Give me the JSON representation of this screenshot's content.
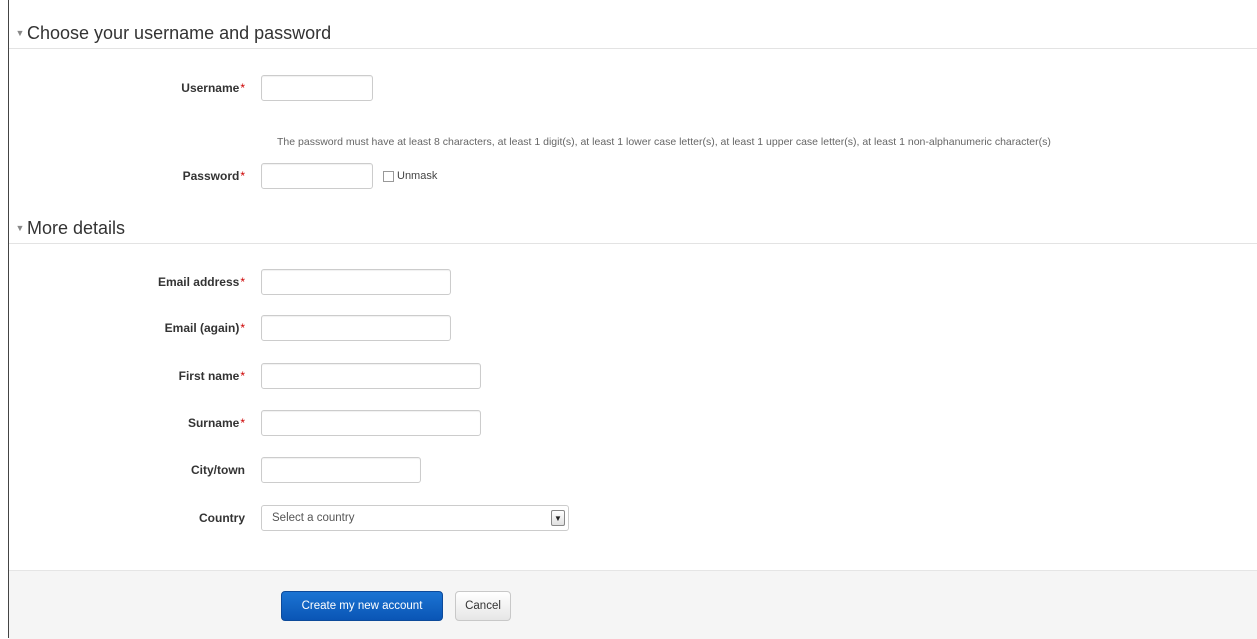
{
  "sections": {
    "credentials": {
      "title": "Choose your username and password",
      "caret": "▼"
    },
    "details": {
      "title": "More details",
      "caret": "▼"
    }
  },
  "fields": {
    "username": {
      "label": "Username",
      "required_marker": "*",
      "value": ""
    },
    "password_help": "The password must have at least 8 characters, at least 1 digit(s), at least 1 lower case letter(s), at least 1 upper case letter(s), at least 1 non-alphanumeric character(s)",
    "password": {
      "label": "Password",
      "required_marker": "*",
      "value": ""
    },
    "unmask": {
      "label": "Unmask",
      "checked": false
    },
    "email": {
      "label": "Email address",
      "required_marker": "*",
      "value": ""
    },
    "email_again": {
      "label": "Email (again)",
      "required_marker": "*",
      "value": ""
    },
    "first_name": {
      "label": "First name",
      "required_marker": "*",
      "value": ""
    },
    "surname": {
      "label": "Surname",
      "required_marker": "*",
      "value": ""
    },
    "city": {
      "label": "City/town",
      "value": ""
    },
    "country": {
      "label": "Country",
      "selected": "Select a country",
      "arrow_icon": "dropdown-arrow"
    }
  },
  "buttons": {
    "submit": "Create my new account",
    "cancel": "Cancel"
  },
  "colors": {
    "primary_button": "#0a55b5",
    "required_marker": "#cc0000",
    "footer_background": "#f5f5f5"
  }
}
